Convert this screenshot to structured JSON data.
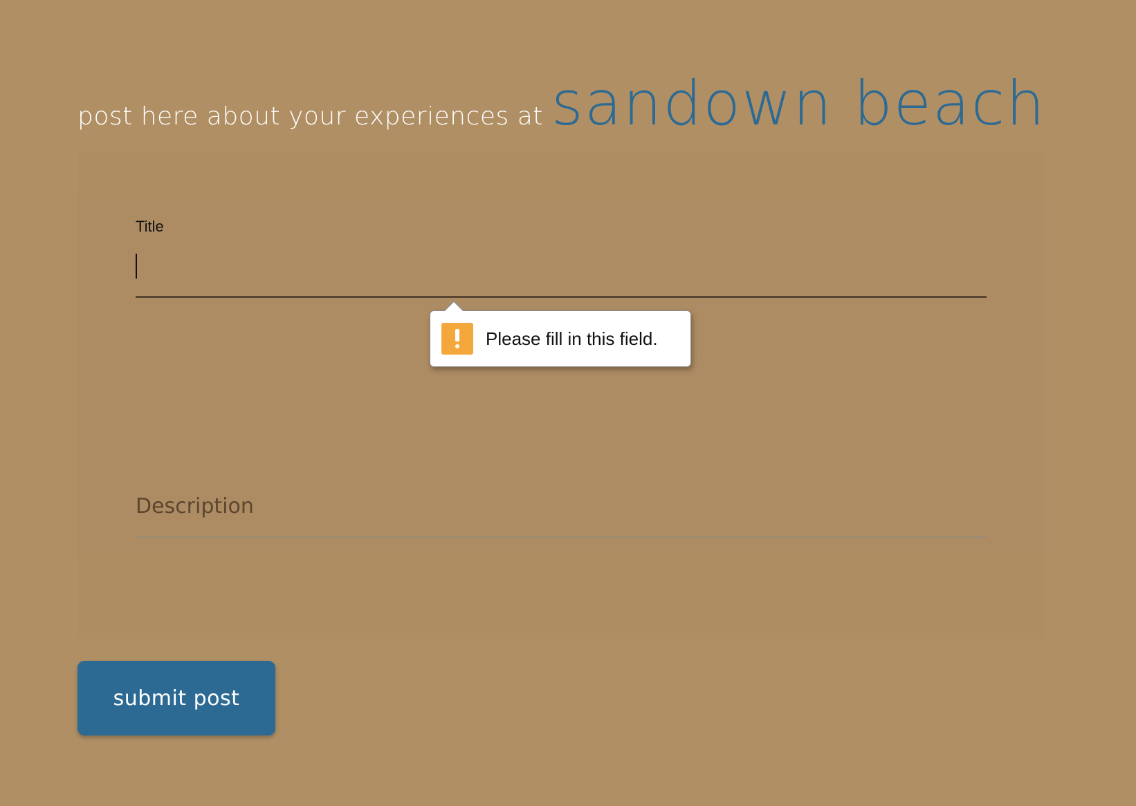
{
  "header": {
    "prefix": "post here about your experiences at",
    "place": "sandown beach"
  },
  "form": {
    "title_label": "Title",
    "title_value": "",
    "description_placeholder": "Description",
    "description_value": "",
    "submit_label": "submit post"
  },
  "validation": {
    "message": "Please fill in this field.",
    "icon": "warning-icon"
  },
  "colors": {
    "background": "#b08f65",
    "accent": "#2d6a93",
    "warning": "#f4a73a"
  }
}
